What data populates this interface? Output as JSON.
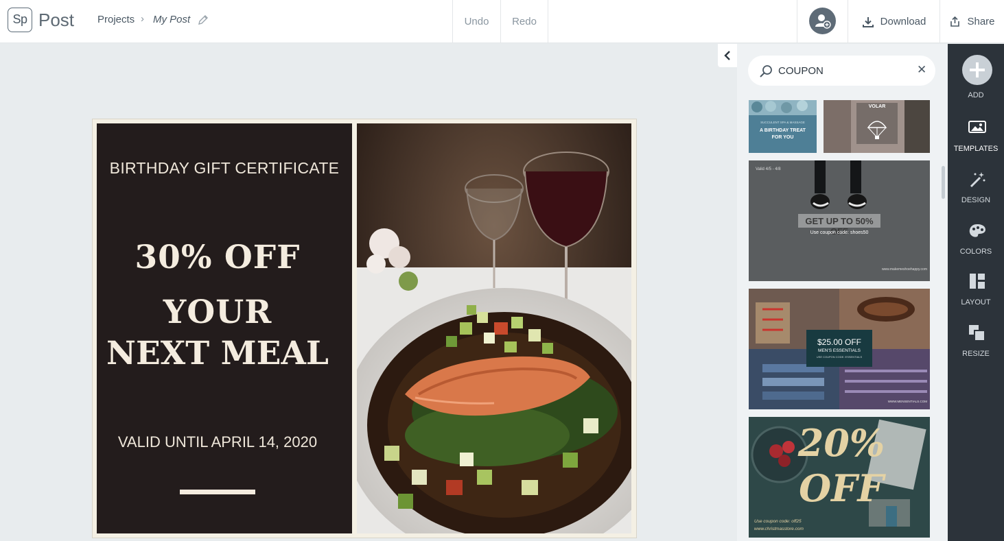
{
  "app": {
    "logo_text": "Sp",
    "name": "Post"
  },
  "breadcrumb": {
    "projects": "Projects",
    "separator": "›",
    "title": "My Post"
  },
  "toolbar": {
    "undo": "Undo",
    "redo": "Redo",
    "download": "Download",
    "share": "Share"
  },
  "canvas": {
    "heading": "BIRTHDAY GIFT CERTIFICATE",
    "line1": "30% OFF",
    "line2": "YOUR",
    "line3": "NEXT MEAL",
    "valid": "VALID UNTIL APRIL 14, 2020",
    "photo_subject": "salmon dinner plate with wine glasses"
  },
  "search": {
    "value": "COUPON",
    "clear": "✕"
  },
  "templates": {
    "t1": {
      "line1": "SUCCULENT SPA & MASSAGE",
      "line2": "A BIRTHDAY TREAT",
      "line3": "FOR YOU"
    },
    "t2": {
      "brand": "VOLAR"
    },
    "t3": {
      "top": "Valid 4/5 - 4/8",
      "headline": "GET UP TO 50% OFF",
      "sub": "Use coupon code: shoes50",
      "site": "www.makemeshoehappy.com"
    },
    "t4": {
      "price": "$25.00 OFF",
      "line": "MEN'S ESSENTIALS",
      "code": "USE COUPON CODE: ESSENTIALS",
      "site": "WWW.MENSENTIALS.COM"
    },
    "t5": {
      "headline1": "20%",
      "headline2": "OFF",
      "code": "Use coupon code: off25",
      "site": "www.christmasstore.com"
    }
  },
  "rail": {
    "add": "ADD",
    "templates": "TEMPLATES",
    "design": "DESIGN",
    "colors": "COLORS",
    "layout": "LAYOUT",
    "resize": "RESIZE"
  },
  "colors": {
    "topbar": "#ffffff",
    "workspace": "#e8ecee",
    "rail": "#2c333a",
    "certificate_dark": "#231c1c",
    "certificate_text": "#f4ecdf"
  }
}
